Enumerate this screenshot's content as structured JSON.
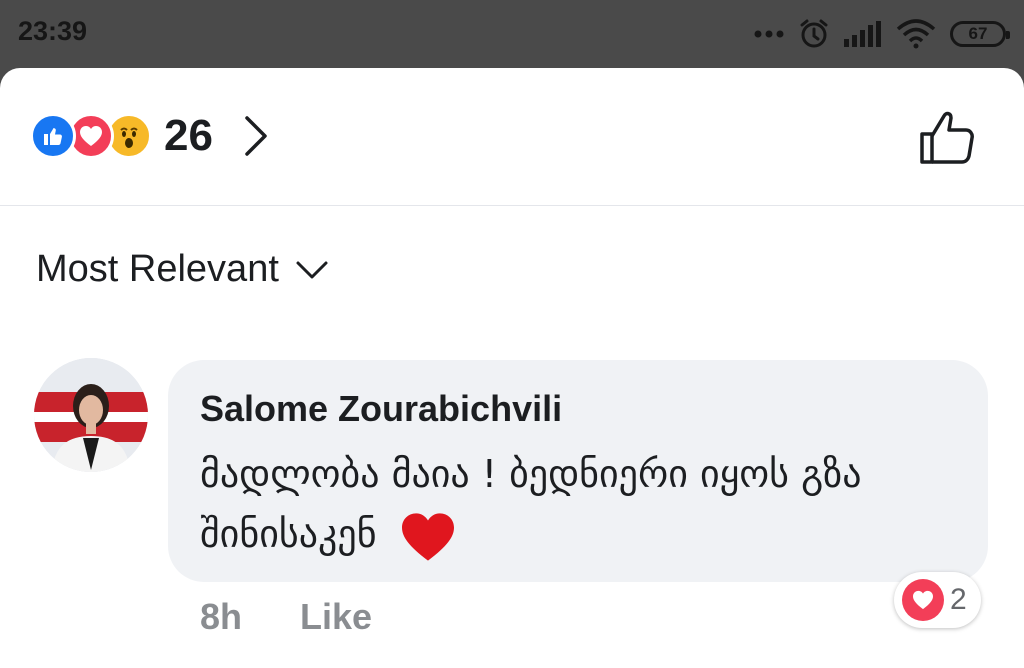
{
  "status_bar": {
    "time": "23:39",
    "battery": "67",
    "icons": [
      "more-dots-icon",
      "alarm-icon",
      "signal-icon",
      "wifi-icon",
      "battery-icon"
    ]
  },
  "reactions": {
    "types": [
      "like",
      "love",
      "wow"
    ],
    "count": "26"
  },
  "sort": {
    "label": "Most Relevant"
  },
  "comment": {
    "author": "Salome Zourabichvili",
    "text": "მადლობა მაია ! ბედნიერი იყოს გზა შინისაკენ",
    "time": "8h",
    "like_label": "Like",
    "reaction_count": "2"
  },
  "colors": {
    "like_blue": "#1877f2",
    "love_red": "#f33e58",
    "wow_yellow": "#f7b928",
    "bubble_bg": "#f0f2f5",
    "meta_gray": "#8a8d91"
  }
}
